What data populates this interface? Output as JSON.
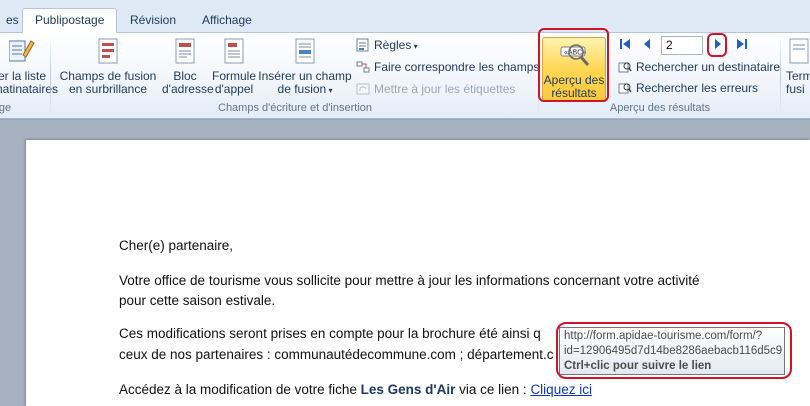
{
  "tabs": {
    "partial_left": "es",
    "items": [
      {
        "label": "Publipostage",
        "active": true
      },
      {
        "label": "Révision",
        "active": false
      },
      {
        "label": "Affichage",
        "active": false
      }
    ]
  },
  "ribbon": {
    "left_partial": {
      "line1": "er la liste",
      "line2": "natinataires",
      "group": "ge"
    },
    "champs_group": {
      "label": "Champs d'écriture et d'insertion",
      "champs_fusion": {
        "line1": "Champs de fusion",
        "line2": "en surbrillance"
      },
      "bloc_adresse": {
        "line1": "Bloc",
        "line2": "d'adresse"
      },
      "formule_appel": {
        "line1": "Formule",
        "line2": "d'appel"
      },
      "inserer_champ": {
        "line1": "Insérer un champ",
        "line2": "de fusion"
      },
      "regles": "Règles",
      "faire_correspondre": "Faire correspondre les champs",
      "mettre_a_jour": "Mettre à jour les étiquettes"
    },
    "apercu_group": {
      "label": "Aperçu des résultats",
      "apercu_button": {
        "line1": "Aperçu des",
        "line2": "résultats"
      },
      "record_number": "2",
      "rechercher_destinataire": "Rechercher un destinataire",
      "rechercher_erreurs": "Rechercher les erreurs"
    },
    "right_partial": {
      "line1": "Term",
      "line2": "fusi"
    }
  },
  "document": {
    "greeting": "Cher(e) partenaire,",
    "para1_line1": "Votre office de tourisme vous sollicite pour mettre à jour les informations concernant votre activité",
    "para1_line2": "pour cette saison estivale.",
    "para2_line1": "Ces modifications seront prises en compte pour la brochure été ainsi q",
    "para2_line2": "ceux de nos partenaires : communautédecommune.com ; département.c",
    "para3_prefix": "Accédez à la modification de votre fiche ",
    "para3_bold": "Les Gens d'Air",
    "para3_mid": " via ce lien : ",
    "para3_link": "Cliquez ici"
  },
  "tooltip": {
    "url_line1": "http://form.apidae-tourisme.com/form/?",
    "url_line2": "id=12906495d7d14be8286aebacb116d5c9",
    "hint": "Ctrl+clic pour suivre le lien"
  },
  "colors": {
    "highlight": "#d0142c",
    "apercu_active": "#ffd754",
    "link": "#0b35c8"
  }
}
